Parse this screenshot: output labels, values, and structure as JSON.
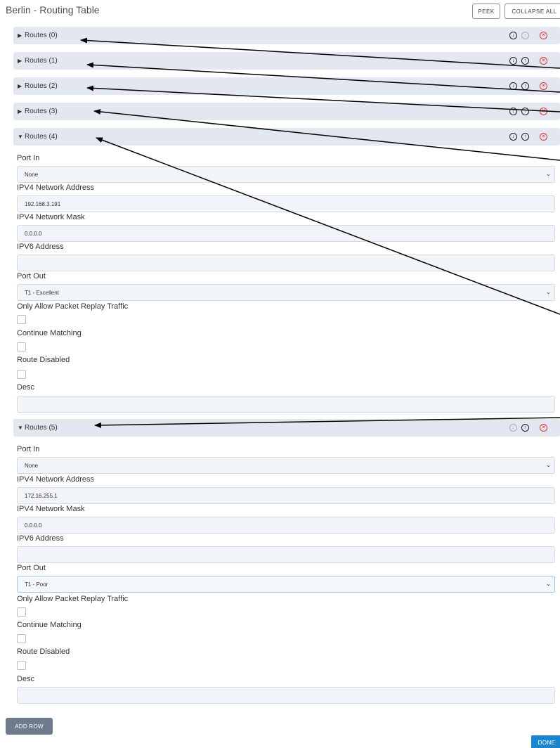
{
  "header": {
    "title": "Berlin - Routing Table",
    "peek_label": "PEEK",
    "collapse_all_label": "COLLAPSE ALL"
  },
  "routes": [
    {
      "label": "Routes (0)",
      "expanded": false
    },
    {
      "label": "Routes (1)",
      "expanded": false
    },
    {
      "label": "Routes (2)",
      "expanded": false
    },
    {
      "label": "Routes (3)",
      "expanded": false
    },
    {
      "label": "Routes (4)",
      "expanded": true
    },
    {
      "label": "Routes (5)",
      "expanded": true
    }
  ],
  "icons": {
    "collapsed": "▶",
    "expanded": "▼",
    "move_down": "↓",
    "move_up": "↑",
    "delete": "✕",
    "chevron": "⌄"
  },
  "route4": {
    "port_in_label": "Port In",
    "port_in_value": "None",
    "ipv4_addr_label": "IPV4 Network Address",
    "ipv4_addr_value": "192.168.3.191",
    "ipv4_mask_label": "IPV4 Network Mask",
    "ipv4_mask_value": "0.0.0.0",
    "ipv6_label": "IPV6 Address",
    "ipv6_value": "",
    "port_out_label": "Port Out",
    "port_out_value": "T1 - Excellent",
    "replay_label": "Only Allow Packet Replay Traffic",
    "continue_label": "Continue Matching",
    "disabled_label": "Route Disabled",
    "desc_label": "Desc",
    "desc_value": ""
  },
  "route5": {
    "port_in_label": "Port In",
    "port_in_value": "None",
    "ipv4_addr_label": "IPV4 Network Address",
    "ipv4_addr_value": "172.16.255.1",
    "ipv4_mask_label": "IPV4 Network Mask",
    "ipv4_mask_value": "0.0.0.0",
    "ipv6_label": "IPV6 Address",
    "ipv6_value": "",
    "port_out_label": "Port Out",
    "port_out_value": "T1 - Poor",
    "replay_label": "Only Allow Packet Replay Traffic",
    "continue_label": "Continue Matching",
    "disabled_label": "Route Disabled",
    "desc_label": "Desc",
    "desc_value": ""
  },
  "footer": {
    "add_row_label": "ADD ROW",
    "done_label": "DONE"
  },
  "colors": {
    "bar": "#e3e8f0",
    "field": "#f1f4f8",
    "primary": "#1a86d0",
    "delete": "#dd3333"
  }
}
